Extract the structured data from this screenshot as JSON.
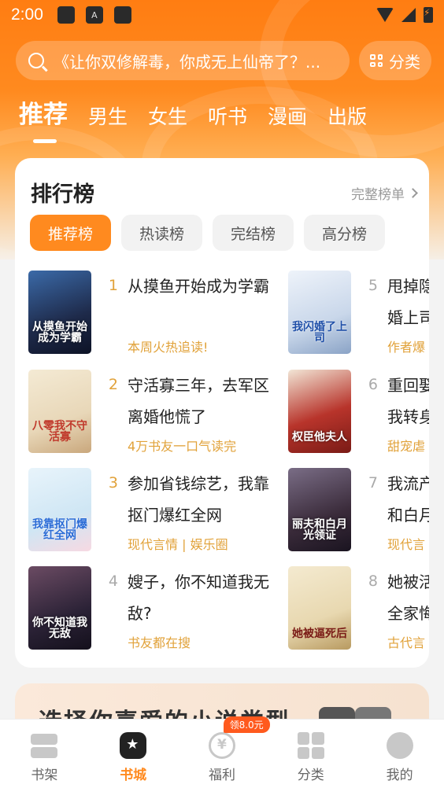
{
  "status_bar": {
    "time": "2:00",
    "icon_a": "A"
  },
  "search": {
    "placeholder_text": "《让你双修解毒，你成无上仙帝了？...",
    "category_label": "分类"
  },
  "top_tabs": [
    {
      "label": "推荐",
      "active": true
    },
    {
      "label": "男生"
    },
    {
      "label": "女生"
    },
    {
      "label": "听书"
    },
    {
      "label": "漫画"
    },
    {
      "label": "出版"
    }
  ],
  "ranking": {
    "title": "排行榜",
    "more_label": "完整榜单",
    "tabs": [
      "推荐榜",
      "热读榜",
      "完结榜",
      "高分榜"
    ],
    "books": [
      {
        "rank": "1",
        "name": "从摸鱼开始成为学霸",
        "tag": "本周火热追读!",
        "cover_text": "从摸鱼开始成为学霸",
        "cover_color": "#1e2a4a"
      },
      {
        "rank": "2",
        "name": "守活寡三年，去军区离婚他慌了",
        "tag": "4万书友一口气读完",
        "cover_text": "八零我不守活寡",
        "cover_color": "#e8d7b8"
      },
      {
        "rank": "3",
        "name": "参加省钱综艺，我靠抠门爆红全网",
        "tag": "现代言情 | 娱乐圈",
        "cover_text": "我靠抠门爆红全网",
        "cover_color": "#cfe6f4"
      },
      {
        "rank": "4",
        "name": "嫂子，你不知道我无敌?",
        "tag": "书友都在搜",
        "cover_text": "你不知道我无敌",
        "cover_color": "#2b2236"
      },
      {
        "rank": "5",
        "name": "甩掉隐婚上司跟上司",
        "tag": "作者爆",
        "cover_text": "我闪婚了上司",
        "cover_color": "#c9d7ea"
      },
      {
        "rank": "6",
        "name": "重回娶我转身",
        "tag": "甜宠虐",
        "cover_text": "权臣他夫人",
        "cover_color": "#b8342b"
      },
      {
        "rank": "7",
        "name": "我流产和白月",
        "tag": "现代言",
        "cover_text": "丽夫和白月光领证",
        "cover_color": "#3a2b3a"
      },
      {
        "rank": "8",
        "name": "她被活全家悔",
        "tag": "古代言",
        "cover_text": "她被逼死后",
        "cover_color": "#e8d8b0"
      }
    ]
  },
  "teaser": {
    "text": "选择你喜爱的小说类型"
  },
  "bottom_nav": [
    {
      "label": "书架"
    },
    {
      "label": "书城",
      "active": true
    },
    {
      "label": "福利",
      "badge": "领8.0元"
    },
    {
      "label": "分类"
    },
    {
      "label": "我的"
    }
  ]
}
